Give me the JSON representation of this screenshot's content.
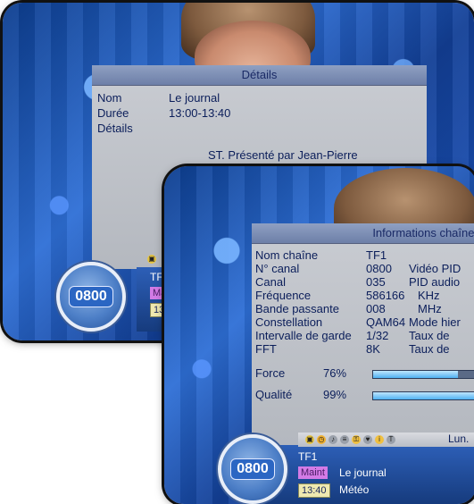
{
  "details_panel": {
    "title": "Détails",
    "labels": {
      "name": "Nom",
      "duration": "Durée",
      "details": "Détails"
    },
    "values": {
      "name": "Le journal",
      "duration": "13:00-13:40"
    },
    "description": "ST. Présenté par Jean-Pierre"
  },
  "back_screen": {
    "channel_number": "0800",
    "channel_name": "TF1",
    "chip_maint": "Mai",
    "chip_time": "13"
  },
  "info_panel": {
    "title": "Informations chaînes",
    "rows": [
      {
        "label": "Nom chaîne",
        "value": "TF1",
        "extra": ""
      },
      {
        "label": "N° canal",
        "value": "0800",
        "extra": "Vidéo PID"
      },
      {
        "label": "Canal",
        "value": "035",
        "extra": "PID audio"
      },
      {
        "label": "Fréquence",
        "value": "586166",
        "extra": "KHz"
      },
      {
        "label": "Bande passante",
        "value": "008",
        "extra": "MHz"
      },
      {
        "label": "Constellation",
        "value": "QAM64",
        "extra": "Mode hier"
      },
      {
        "label": "Intervalle de garde",
        "value": "1/32",
        "extra": "Taux de"
      },
      {
        "label": "FFT",
        "value": "8K",
        "extra": "Taux de"
      }
    ],
    "force": {
      "label": "Force",
      "value": "76%",
      "fraction": 0.76
    },
    "quality": {
      "label": "Qualité",
      "value": "99%",
      "fraction": 0.99
    }
  },
  "front_bar": {
    "channel_number": "0800",
    "channel_name": "TF1",
    "chip_maint": "Maint",
    "program_now": "Le journal",
    "chip_time": "13:40",
    "program_next": "Météo",
    "day": "Lun."
  },
  "colors": {
    "panel_text": "#0b1e5a",
    "chip_maint": "#d37be6",
    "meter_fill": "#4fb0f0"
  },
  "icons": [
    "tv-icon",
    "clock-icon",
    "audio-icon",
    "subtitle-icon",
    "lock-icon",
    "favorite-icon",
    "info-icon",
    "teletext-icon"
  ]
}
